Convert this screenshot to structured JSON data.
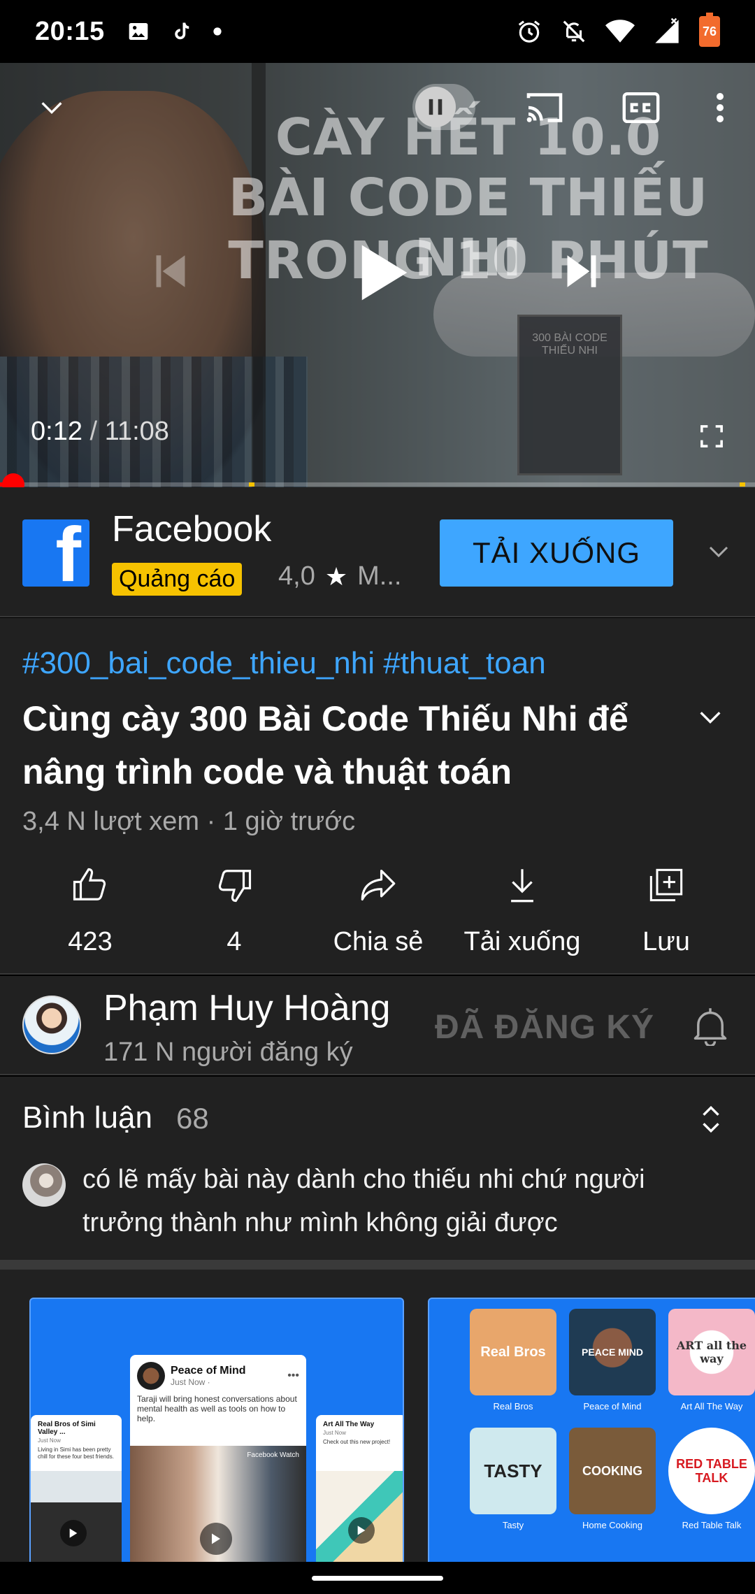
{
  "status_bar": {
    "time": "20:15",
    "left_icons": [
      "image-icon",
      "tiktok-icon",
      "dot-icon"
    ],
    "right_icons": [
      "alarm-icon",
      "mute-icon",
      "wifi-icon",
      "signal-icon"
    ],
    "battery_level": "76"
  },
  "player": {
    "title_overlay": [
      "CÀY HẾT 10.0",
      "BÀI CODE THIẾU NHI",
      "TRONG 10 PHÚT"
    ],
    "book_label": "300 BÀI CODE THIẾU NHI",
    "current_time": "0:12",
    "separator": " / ",
    "duration": "11:08",
    "progress_fraction": 0.018,
    "ad_marker_fractions": [
      0.33,
      0.98
    ],
    "colors": {
      "progress": "#ff0000",
      "ad_marker": "#f6c200"
    }
  },
  "ad": {
    "brand_letter": "f",
    "title": "Facebook",
    "badge": "Quảng cáo",
    "rating": "4,0",
    "rating_suffix": "M...",
    "cta": "TẢI XUỐNG",
    "colors": {
      "brand": "#1877f2",
      "cta": "#3ea6ff",
      "badge": "#f6c200"
    }
  },
  "video": {
    "hashtags": "#300_bai_code_thieu_nhi #thuat_toan",
    "title": "Cùng cày 300 Bài Code Thiếu Nhi để nâng trình code và thuật toán",
    "meta": "3,4 N lượt xem · 1 giờ trước",
    "actions": [
      {
        "icon": "like-icon",
        "label": "423"
      },
      {
        "icon": "dislike-icon",
        "label": "4"
      },
      {
        "icon": "share-icon",
        "label": "Chia sẻ"
      },
      {
        "icon": "download-icon",
        "label": "Tải xuống"
      },
      {
        "icon": "save-playlist-icon",
        "label": "Lưu"
      }
    ]
  },
  "channel": {
    "name": "Phạm Huy Hoàng",
    "subscribers": "171 N người đăng ký",
    "subscribe_state": "ĐÃ ĐĂNG KÝ"
  },
  "comments": {
    "title": "Bình luận",
    "count": "68",
    "top_comment": "có lẽ mấy bài này dành cho thiếu nhi chứ người trưởng thành như mình không giải được"
  },
  "carousel": {
    "card1": {
      "main_title": "Peace of Mind",
      "main_sub": "Just Now ·",
      "main_body": "Taraji will bring honest conversations about mental health as well as tools on how to help.",
      "left_title": "Real Bros of Simi Valley ...",
      "left_sub": "Just Now",
      "left_body": "Living in Simi has been pretty chill for these four best friends.",
      "right_title": "Art All The Way",
      "right_sub": "Just Now",
      "right_body": "Check out this new project!",
      "watermark": "Facebook Watch"
    },
    "card2": {
      "shows": [
        {
          "tile": "Real Bros",
          "label": "Real Bros"
        },
        {
          "tile": "PEACE MIND",
          "label": "Peace of Mind"
        },
        {
          "tile": "ART all the way",
          "label": "Art All The Way"
        },
        {
          "tile": "TASTY",
          "label": "Tasty"
        },
        {
          "tile": "COOKING",
          "label": "Home Cooking"
        },
        {
          "tile": "RED TABLE TALK",
          "label": "Red Table Talk"
        }
      ]
    }
  }
}
